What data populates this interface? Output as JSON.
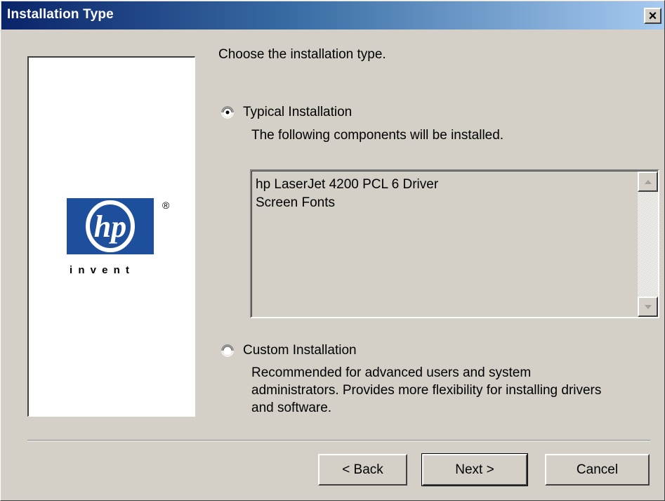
{
  "window": {
    "title": "Installation Type",
    "close_glyph": "×"
  },
  "logo": {
    "icon": "hp-logo-icon",
    "tagline": "i n v e n t",
    "registered": "®",
    "brand_color": "#1e4f9c"
  },
  "prompt": "Choose the installation type.",
  "options": {
    "typical": {
      "label": "Typical Installation",
      "description": "The following components will be installed.",
      "selected": true
    },
    "custom": {
      "label": "Custom Installation",
      "description_lines": [
        "Recommended for advanced users and system",
        "administrators.  Provides more flexibility for installing drivers",
        "and software."
      ],
      "selected": false
    }
  },
  "components": {
    "items": [
      "hp LaserJet 4200 PCL 6 Driver",
      "Screen Fonts"
    ]
  },
  "buttons": {
    "back": "< Back",
    "next": "Next >",
    "cancel": "Cancel"
  }
}
